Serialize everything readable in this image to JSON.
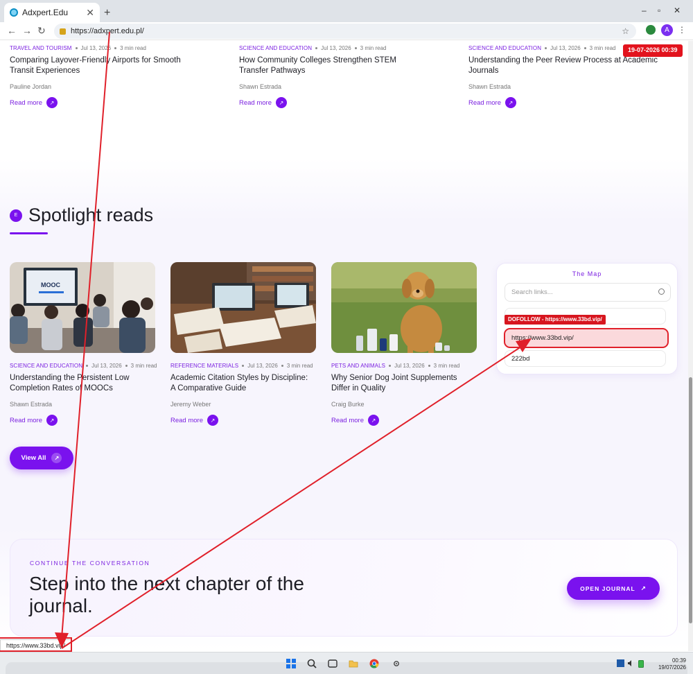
{
  "browser": {
    "tab_title": "Adxpert.Edu",
    "tab_close": "✕",
    "new_tab": "+",
    "url": "https://adxpert.edu.pl/",
    "profile_initial": "A",
    "minimize": "–",
    "restore": "▫",
    "close": "✕",
    "back": "←",
    "forward": "→",
    "reload": "↻",
    "star": "☆",
    "menu": "⋮"
  },
  "top_cards": [
    {
      "category": "TRAVEL AND TOURISM",
      "date": "Jul 13, 2026",
      "read": "3 min read",
      "title": "Comparing Layover-Friendly Airports for Smooth Transit Experiences",
      "author": "Pauline Jordan",
      "cta": "Read more"
    },
    {
      "category": "SCIENCE AND EDUCATION",
      "date": "Jul 13, 2026",
      "read": "3 min read",
      "title": "How Community Colleges Strengthen STEM Transfer Pathways",
      "author": "Shawn Estrada",
      "cta": "Read more"
    },
    {
      "category": "SCIENCE AND EDUCATION",
      "date": "Jul 13, 2026",
      "read": "3 min read",
      "title": "Understanding the Peer Review Process at Academic Journals",
      "author": "Shawn Estrada",
      "cta": "Read more"
    }
  ],
  "timestamp_badge": "19-07-2026 00:39",
  "spotlight": {
    "badge": "E",
    "title": "Spotlight reads",
    "cards": [
      {
        "category": "SCIENCE AND EDUCATION",
        "date": "Jul 13, 2026",
        "read": "3 min read",
        "title": "Understanding the Persistent Low Completion Rates of MOOCs",
        "author": "Shawn Estrada",
        "cta": "Read more",
        "screen_text": "MOOC"
      },
      {
        "category": "REFERENCE MATERIALS",
        "date": "Jul 13, 2026",
        "read": "3 min read",
        "title": "Academic Citation Styles by Discipline: A Comparative Guide",
        "author": "Jeremy Weber",
        "cta": "Read more"
      },
      {
        "category": "PETS AND ANIMALS",
        "date": "Jul 13, 2026",
        "read": "3 min read",
        "title": "Why Senior Dog Joint Supplements Differ in Quality",
        "author": "Craig Burke",
        "cta": "Read more"
      }
    ],
    "view_all": "View All"
  },
  "map": {
    "title": "The Map",
    "search_placeholder": "Search links...",
    "dofollow_label": "DOFOLLOW - https://www.33bd.vip/",
    "links": [
      "https://www.33bd.vip/",
      "222bd"
    ]
  },
  "cta": {
    "kicker": "CONTINUE THE CONVERSATION",
    "title": "Step into the next chapter of the journal.",
    "button": "OPEN JOURNAL"
  },
  "status_url": "https://www.33bd.vip/",
  "taskbar": {
    "time": "00:39",
    "date": "19/07/2026"
  },
  "colors": {
    "accent": "#7a12ee",
    "annotation_red": "#e0202a"
  }
}
